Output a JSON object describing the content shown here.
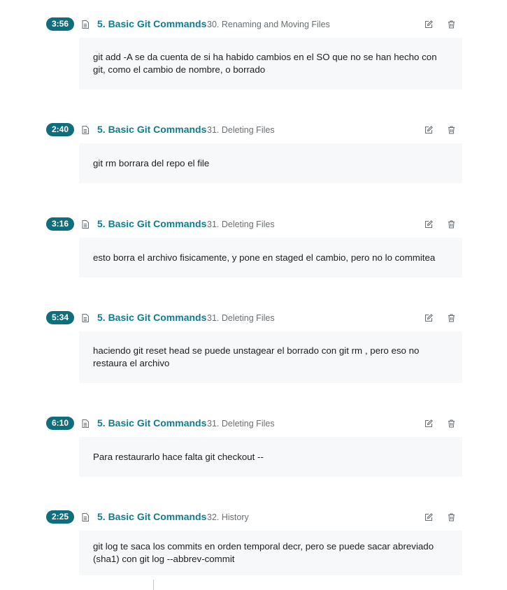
{
  "notes": [
    {
      "timestamp": "3:56",
      "section": "5. Basic Git Commands",
      "lecture": "30. Renaming and Moving Files",
      "text": "git add -A se da cuenta de si ha habido cambios en el SO que no se han hecho con git, como el cambio de nombre, o borrado"
    },
    {
      "timestamp": "2:40",
      "section": "5. Basic Git Commands",
      "lecture": "31. Deleting Files",
      "text": "git rm borrara del repo el file"
    },
    {
      "timestamp": "3:16",
      "section": "5. Basic Git Commands",
      "lecture": "31. Deleting Files",
      "text": "esto borra el archivo fisicamente, y pone en staged el cambio, pero no lo commitea"
    },
    {
      "timestamp": "5:34",
      "section": "5. Basic Git Commands",
      "lecture": "31. Deleting Files",
      "text": "haciendo git reset head se puede unstagear el borrado con git rm , pero eso no restaura el archivo"
    },
    {
      "timestamp": "6:10",
      "section": "5. Basic Git Commands",
      "lecture": "31. Deleting Files",
      "text": "Para restaurarlo hace falta git checkout --"
    },
    {
      "timestamp": "2:25",
      "section": "5. Basic Git Commands",
      "lecture": "32. History",
      "text": "git log te saca los commits en orden temporal decr, pero se puede sacar abreviado (sha1) con git log --abbrev-commit"
    }
  ],
  "icons": {
    "lecture": "document-icon",
    "edit": "edit-icon",
    "delete": "trash-icon"
  },
  "colors": {
    "timestamp_bg": "#0f6d7c",
    "section_link": "#0f7c90",
    "lecture_text": "#6a6f73",
    "note_bg": "#f7f8fa",
    "icon": "#6a6f73"
  }
}
